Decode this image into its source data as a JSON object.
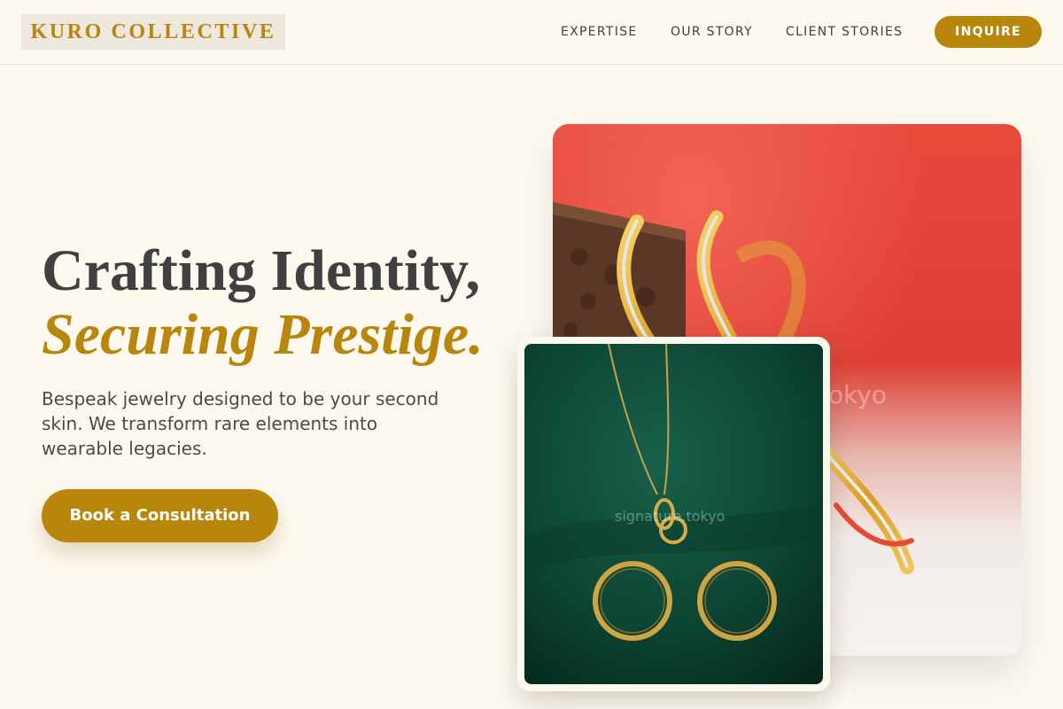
{
  "header": {
    "logo": "KURO COLLECTIVE",
    "nav": [
      "EXPERTISE",
      "OUR STORY",
      "CLIENT STORIES"
    ],
    "inquire": "INQUIRE"
  },
  "hero": {
    "headline_line1": "Crafting Identity,",
    "headline_line2": "Securing Prestige.",
    "description": "Bespeak jewelry designed to be your second skin. We transform rare elements into wearable legacies.",
    "cta": "Book a Consultation"
  },
  "images": {
    "back_watermark": "tokyo",
    "front_watermark": "signature.tokyo"
  },
  "colors": {
    "background": "#fdf9ee",
    "accent_gold": "#b8860b",
    "text_dark": "#404040",
    "back_image_red": "#e2453a",
    "front_image_green": "#0f4a38"
  }
}
